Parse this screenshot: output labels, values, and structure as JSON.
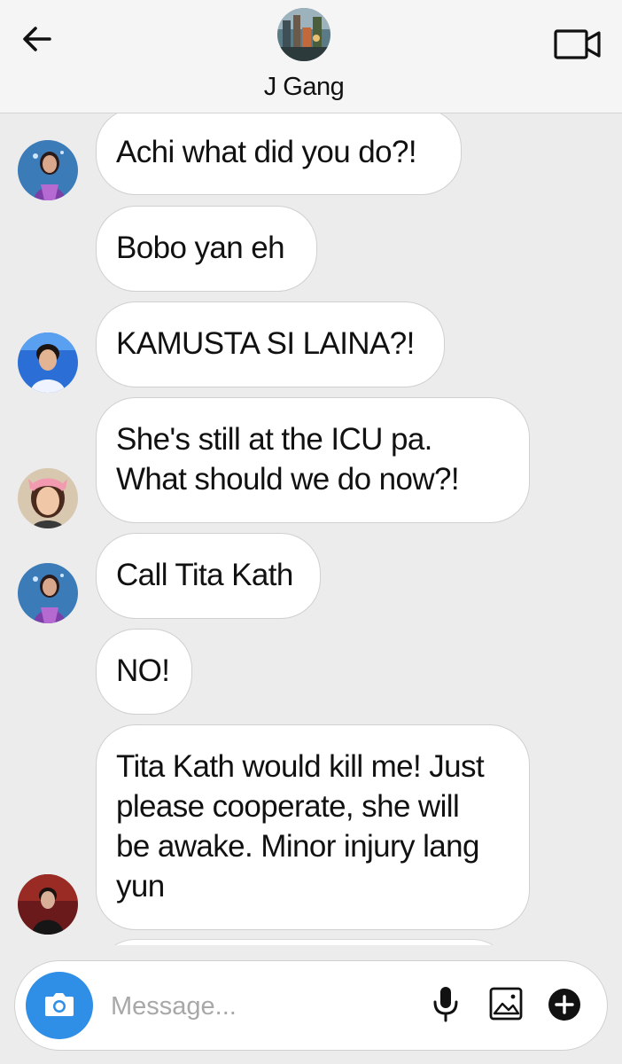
{
  "header": {
    "title": "J Gang",
    "back_icon": "arrow-left-icon",
    "video_icon": "video-camera-icon"
  },
  "messages": [
    {
      "text": "Achi what did you do?!",
      "avatar": "avatar-1"
    },
    {
      "text": "Bobo yan eh",
      "avatar": ""
    },
    {
      "text": "KAMUSTA SI LAINA?!",
      "avatar": "avatar-2"
    },
    {
      "text_lines": [
        "She's still at the ICU pa.",
        "What should we do now?!"
      ],
      "avatar": "avatar-3"
    },
    {
      "text": "Call Tita Kath",
      "avatar": "avatar-1"
    },
    {
      "text": "NO!",
      "avatar": ""
    },
    {
      "text_lines": [
        "Tita Kath would kill me! Just",
        "please cooperate, she will",
        "be awake. Minor injury lang",
        "yun"
      ],
      "avatar": "avatar-4"
    }
  ],
  "composer": {
    "placeholder": "Message...",
    "camera_icon": "camera-icon",
    "mic_icon": "microphone-icon",
    "gallery_icon": "image-icon",
    "plus_icon": "plus-circle-icon"
  },
  "colors": {
    "background": "#ececec",
    "header_bg": "#f5f5f5",
    "bubble_bg": "#ffffff",
    "accent_blue": "#2f8fe6"
  }
}
